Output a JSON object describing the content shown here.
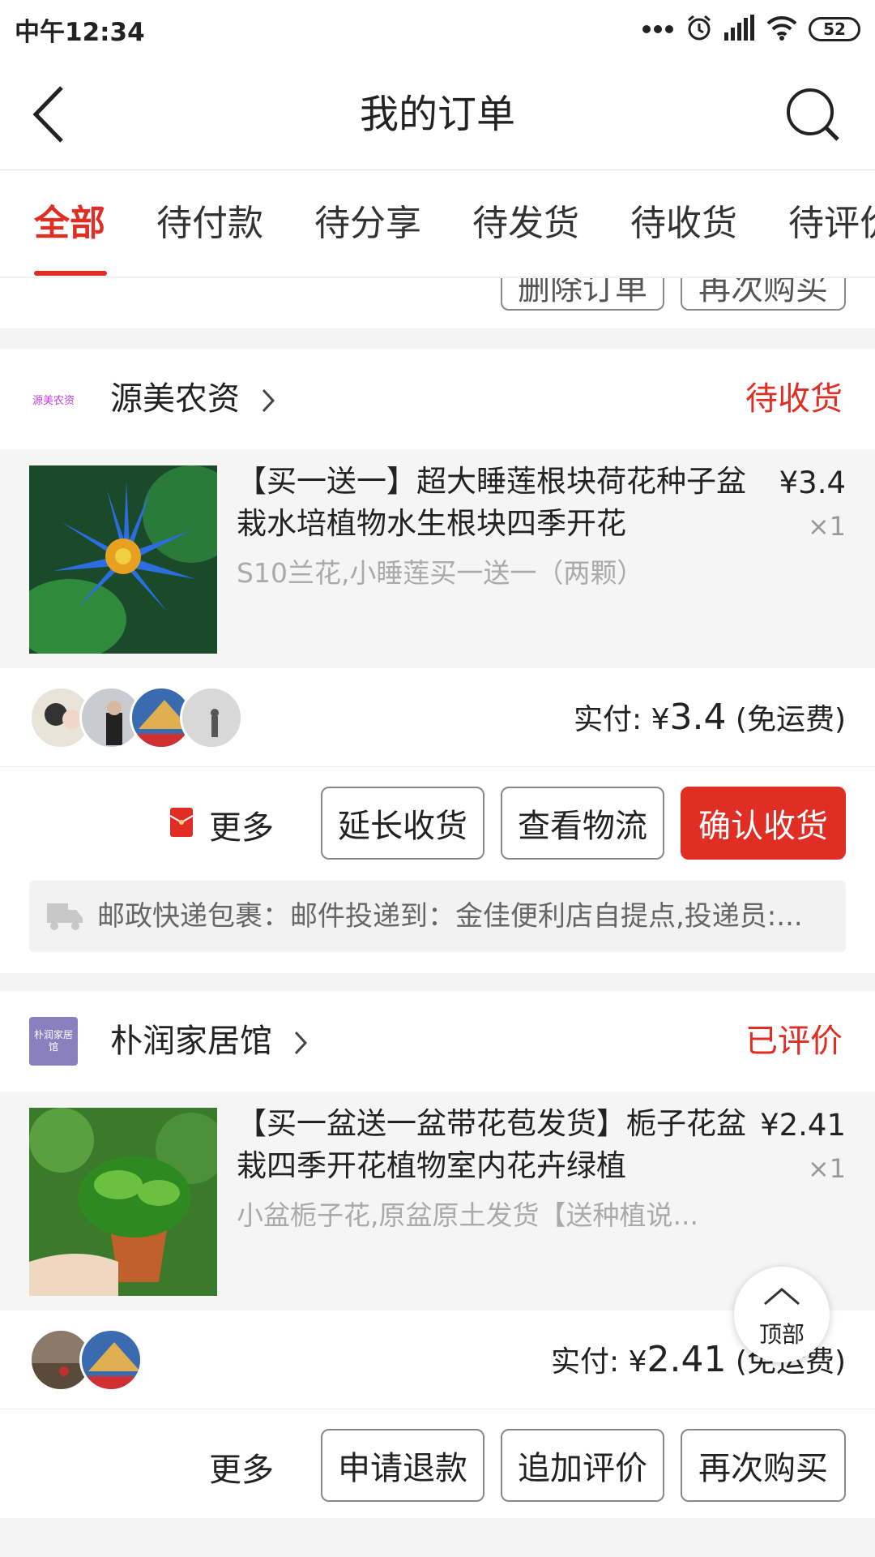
{
  "status": {
    "time": "中午12:34",
    "battery": "52"
  },
  "header": {
    "title": "我的订单"
  },
  "tabs": [
    {
      "label": "全部"
    },
    {
      "label": "待付款"
    },
    {
      "label": "待分享"
    },
    {
      "label": "待发货"
    },
    {
      "label": "待收货"
    },
    {
      "label": "待评价"
    }
  ],
  "previous_order": {
    "buttons": [
      "删除订单",
      "再次购买"
    ]
  },
  "orders": [
    {
      "shop_name": "源美农资",
      "shop_logo_text": "源美农资",
      "status": "待收货",
      "goods_title": "【买一送一】超大睡莲根块荷花种子盆栽水培植物水生根块四季开花",
      "goods_spec": "S10兰花,小睡莲买一送一（两颗）",
      "price": "¥3.4",
      "qty": "×1",
      "pay_label": "实付: ",
      "pay_currency": "¥",
      "pay_amount": "3.4",
      "pay_note": " (免运费)",
      "more": "更多",
      "buttons": [
        "延长收货",
        "查看物流",
        "确认收货"
      ],
      "logistics": "邮政快递包裹：邮件投递到：金佳便利店自提点,投递员:..."
    },
    {
      "shop_name": "朴润家居馆",
      "shop_logo_text": "朴润家居馆",
      "status": "已评价",
      "goods_title": "【买一盆送一盆带花苞发货】栀子花盆栽四季开花植物室内花卉绿植",
      "goods_spec": "小盆栀子花,原盆原土发货【送种植说...",
      "price": "¥2.41",
      "qty": "×1",
      "pay_label": "实付: ",
      "pay_currency": "¥",
      "pay_amount": "2.41",
      "pay_note": " (免运费)",
      "more": "更多",
      "buttons": [
        "申请退款",
        "追加评价",
        "再次购买"
      ]
    }
  ],
  "back_to_top": "顶部",
  "colors": {
    "accent": "#e02e24"
  }
}
